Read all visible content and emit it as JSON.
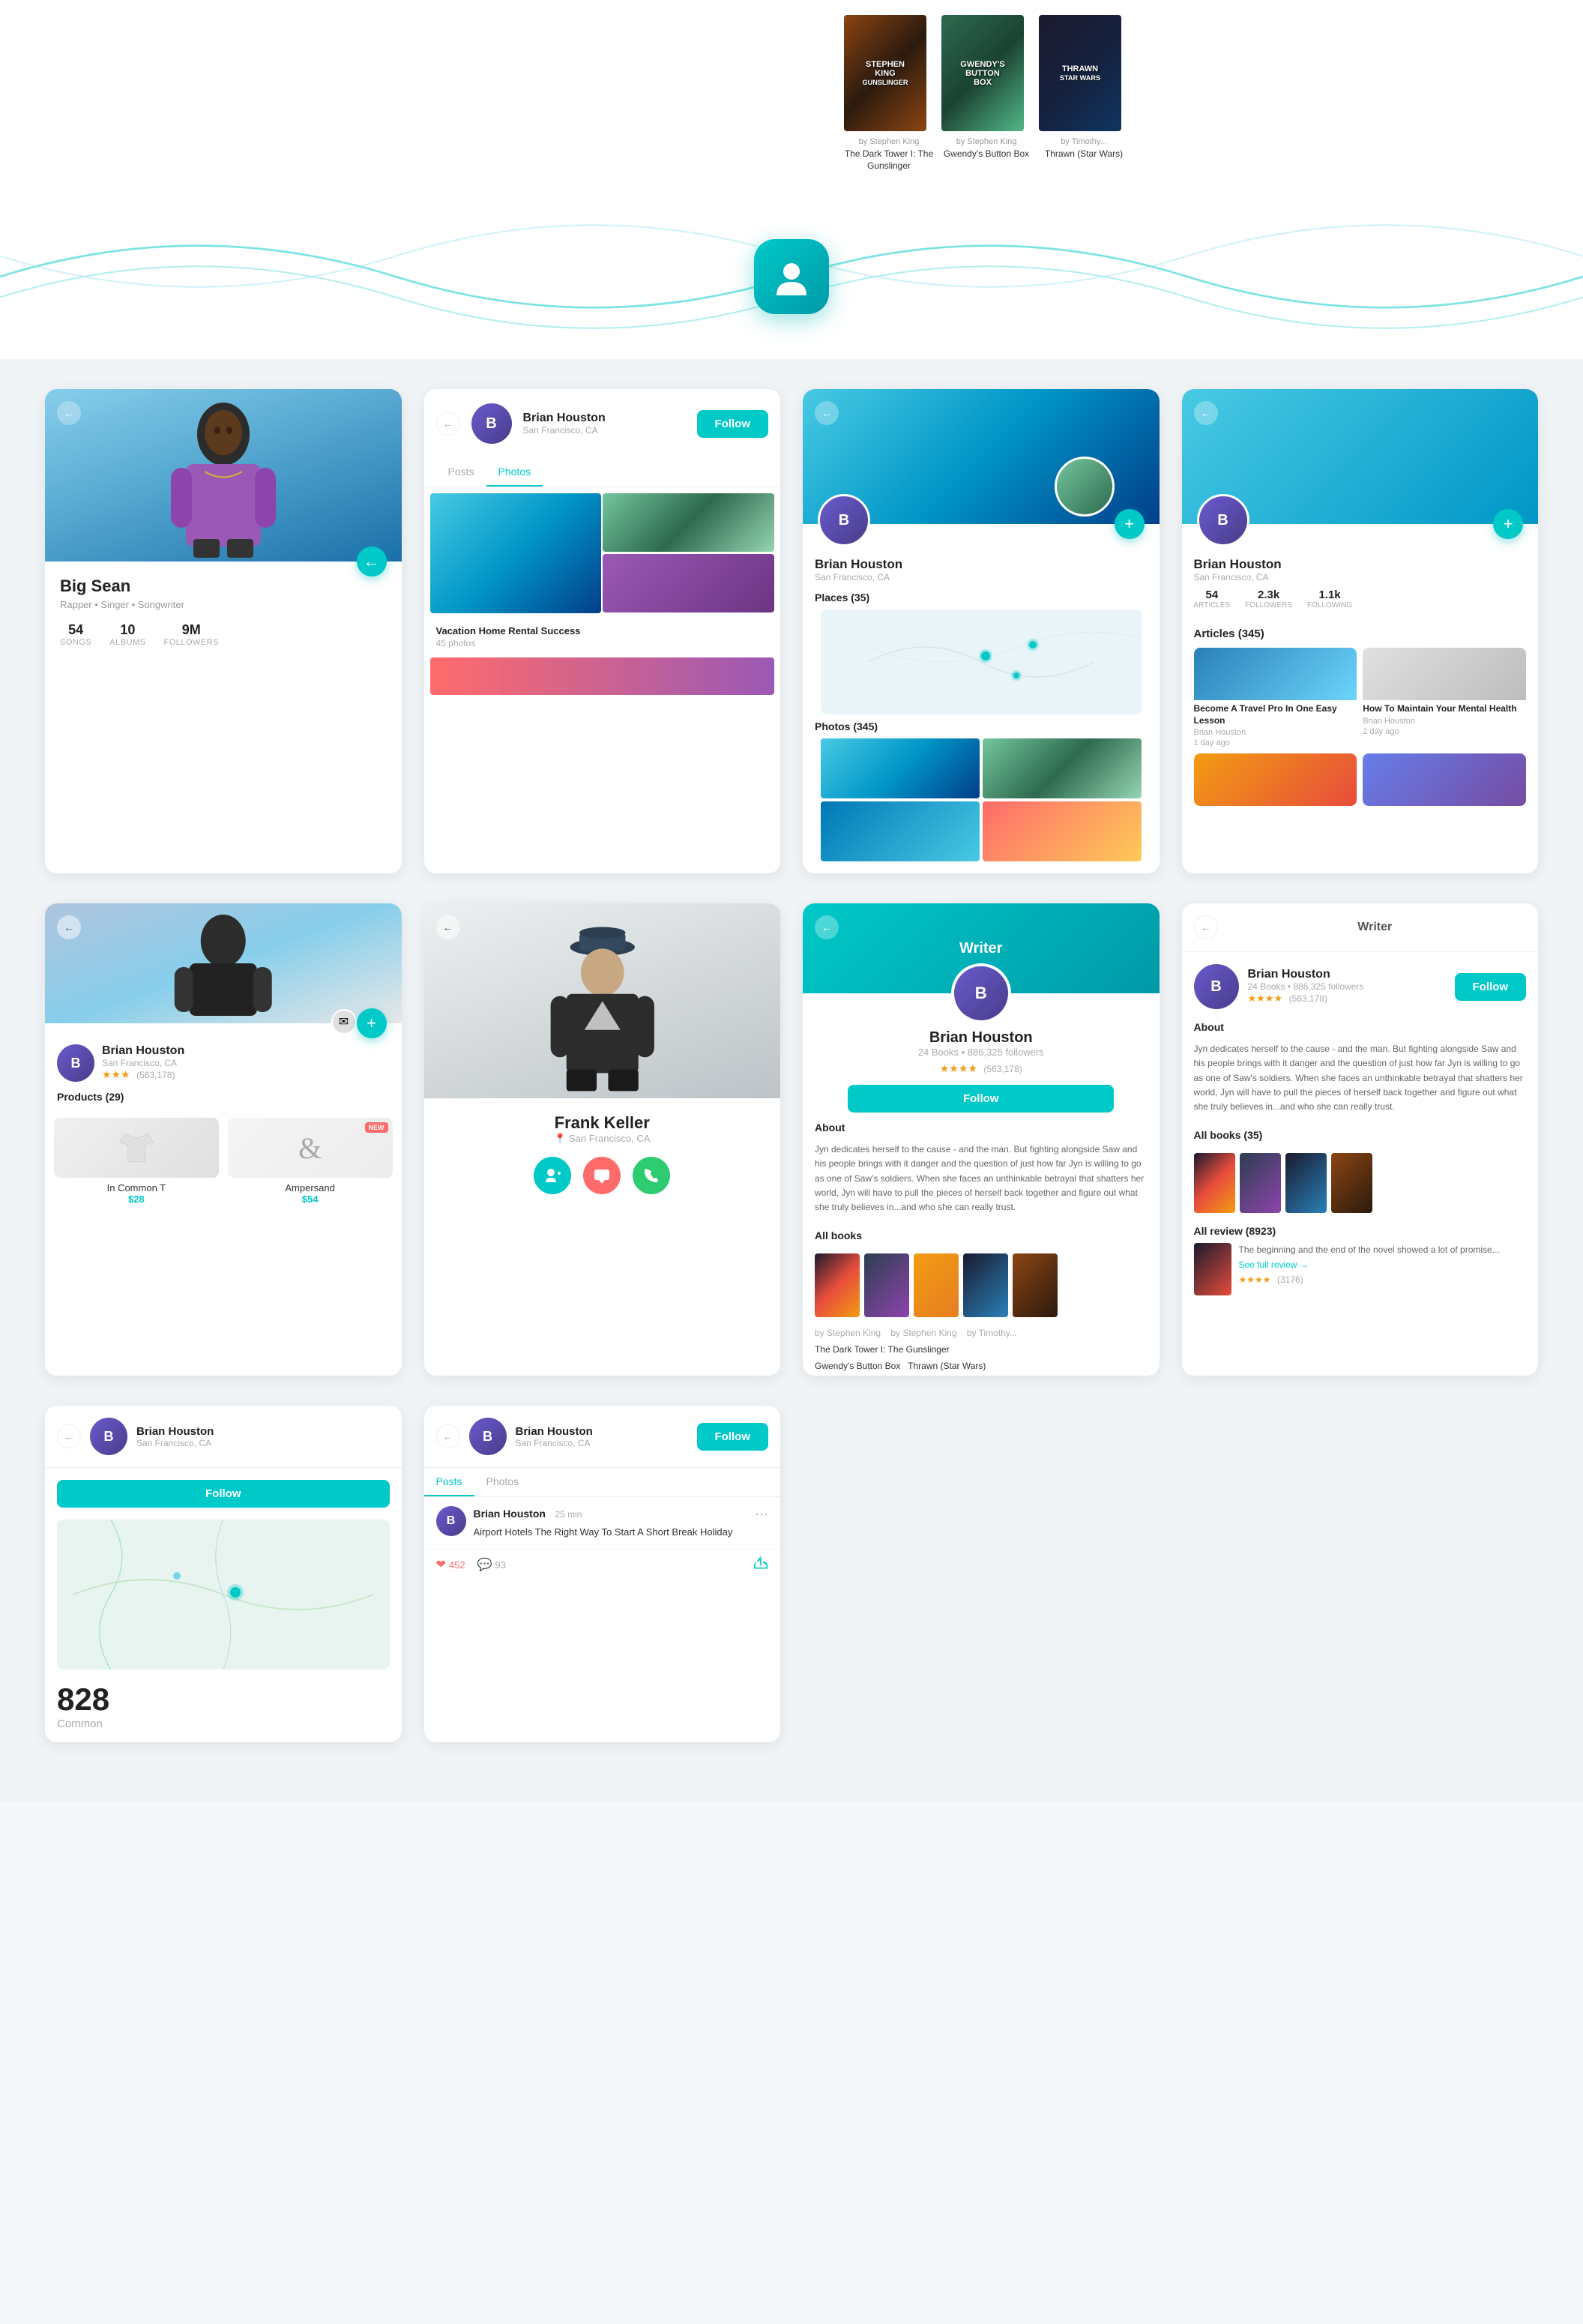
{
  "top": {
    "books": [
      {
        "author": "by Stephen King",
        "title": "The Dark Tower I: The Gunslinger",
        "cover_style": "gunslinger",
        "cover_text": "STEPHEN KING\nGUNSLINGER"
      },
      {
        "author": "by Stephen King",
        "title": "Gwendy's Button Box",
        "cover_style": "gwendy",
        "cover_text": "GWENDY'S\nBUTTON BOX"
      },
      {
        "author": "by Timothy...",
        "title": "Thrawn (Star Wars)",
        "cover_style": "thrawn",
        "cover_text": "THRAWN\nSTAR WARS"
      }
    ]
  },
  "profile_icon": "👤",
  "cards_row1": {
    "card1": {
      "name": "Big Sean",
      "subtitle": "Rapper • Singer • Songwriter",
      "stats": [
        {
          "value": "54",
          "label": "SONGS"
        },
        {
          "value": "10",
          "label": "ALBUMS"
        },
        {
          "value": "9M",
          "label": "FOLLOWERS"
        }
      ],
      "back": "←"
    },
    "card2": {
      "name": "Brian Houston",
      "location": "San Francisco, CA",
      "tabs": [
        "Posts",
        "Photos"
      ],
      "active_tab": "Photos",
      "photo_label": "Vacation Home Rental Success",
      "photo_sublabel": "45 photos",
      "follow_label": "Follow",
      "back": "←"
    },
    "card3": {
      "name": "Brian Houston",
      "location": "San Francisco, CA",
      "places_label": "Places (35)",
      "photos_label": "Photos (345)",
      "back": "←",
      "plus_label": "+"
    },
    "card4": {
      "name": "Brian Houston",
      "location": "San Francisco, CA",
      "stats": [
        {
          "value": "54",
          "label": "ARTICLES"
        },
        {
          "value": "2.3k",
          "label": "FOLLOWERS"
        },
        {
          "value": "1.1k",
          "label": "FOLLOWING"
        }
      ],
      "articles_label": "Articles (345)",
      "articles": [
        {
          "title": "Become A Travel Pro In One Easy Lesson",
          "author": "Brian Houston",
          "time": "1 day ago",
          "thumb": "waterfall"
        },
        {
          "title": "How To Maintain Your Mental Health",
          "author": "Brian Houston",
          "time": "2 day ago",
          "thumb": "snow"
        }
      ],
      "back": "←",
      "plus_label": "+"
    }
  },
  "cards_row2": {
    "card5": {
      "name": "Brian Houston",
      "location": "San Francisco, CA",
      "rating": "★★★",
      "rating_count": "(563,178)",
      "products_label": "Products (29)",
      "products": [
        {
          "name": "In Common T",
          "price": "$28",
          "style": "tshirt"
        },
        {
          "name": "Ampersand",
          "price": "$54",
          "style": "ampersand",
          "new": true
        }
      ],
      "back": "←",
      "msg_icon": "✉",
      "plus_label": "+"
    },
    "card6": {
      "name": "Frank Keller",
      "location": "San Francisco, CA",
      "back": "←",
      "actions": [
        "👤+",
        "💬",
        "📞"
      ]
    },
    "card7": {
      "header_label": "Writer",
      "name": "Brian Houston",
      "books_info": "24 Books • 886,325 followers",
      "rating": "★★★★",
      "rating_count": "(563,178)",
      "follow_label": "Follow",
      "about_label": "About",
      "about_text": "Jyn dedicates herself to the cause - and the man. But fighting alongside Saw and his people brings with it danger and the question of just how far Jyn is willing to go as one of Saw's soldiers. When she faces an unthinkable betrayal that shatters her world, Jyn will have to pull the pieces of herself back together and figure out what she truly believes in...and who she can really trust.",
      "all_books_label": "All books",
      "back": "←"
    },
    "card8": {
      "header_label": "Writer",
      "name": "Brian Houston",
      "books_info": "24 Books • 886,325 followers",
      "rating": "★★★★",
      "rating_count": "(563,178)",
      "follow_label": "Follow",
      "about_label": "About",
      "about_text": "Jyn dedicates herself to the cause - and the man. But fighting alongside Saw and his people brings with it danger and the question of just how far Jyn is willing to go as one of Saw's soldiers. When she faces an unthinkable betrayal that shatters her world, Jyn will have to pull the pieces of herself back together and figure out what she truly believes in...and who she can really trust.",
      "all_books_label": "All books (35)",
      "all_review_label": "All review (8923)",
      "review_text": "The beginning and the end of the novel showed a lot of promise...",
      "see_full_review": "See full review →",
      "review_rating": "★★★★",
      "review_count": "(3176)",
      "back": "←"
    }
  },
  "cards_row3": {
    "card9": {
      "name": "Brian Houston",
      "location": "San Francisco, CA",
      "follow_label": "Follow",
      "back": "←",
      "common_label": "Common",
      "common_count": "828"
    },
    "card10": {
      "name": "Brian Houston",
      "location": "San Francisco, CA",
      "follow_label": "Follow",
      "tabs": [
        "Posts",
        "Photos"
      ],
      "active_tab": "Posts",
      "post": {
        "author": "Brian Houston",
        "time": "25 min",
        "content": "Airport Hotels The Right Way To Start A Short Break Holiday",
        "likes": "452",
        "comments": "93"
      },
      "back": "←"
    }
  }
}
